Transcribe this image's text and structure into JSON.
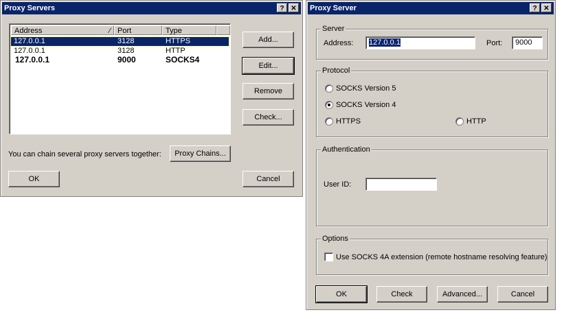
{
  "proxy_servers": {
    "title": "Proxy Servers",
    "columns": [
      "Address",
      "Port",
      "Type"
    ],
    "rows": [
      {
        "address": "127.0.0.1",
        "port": "3128",
        "type": "HTTPS"
      },
      {
        "address": "127.0.0.1",
        "port": "3128",
        "type": "HTTP"
      },
      {
        "address": "127.0.0.1",
        "port": "9000",
        "type": "SOCKS4"
      }
    ],
    "buttons": {
      "add": "Add...",
      "edit": "Edit...",
      "remove": "Remove",
      "check": "Check...",
      "ok": "OK",
      "cancel": "Cancel",
      "chains": "Proxy Chains..."
    },
    "chain_text": "You can chain several proxy servers together:"
  },
  "proxy_server": {
    "title": "Proxy Server",
    "server_group": "Server",
    "address_label": "Address:",
    "address_value": "127.0.0.1",
    "port_label": "Port:",
    "port_value": "9000",
    "protocol_group": "Protocol",
    "protocols": {
      "socks5": "SOCKS Version 5",
      "socks4": "SOCKS Version 4",
      "https": "HTTPS",
      "http": "HTTP"
    },
    "selected_protocol": "socks4",
    "auth_group": "Authentication",
    "userid_label": "User ID:",
    "userid_value": "",
    "options_group": "Options",
    "socks4a_label": "Use SOCKS 4A extension (remote hostname resolving feature)",
    "buttons": {
      "ok": "OK",
      "check": "Check",
      "advanced": "Advanced...",
      "cancel": "Cancel"
    }
  },
  "titlebar_buttons": {
    "help": "?",
    "close": "✕"
  }
}
